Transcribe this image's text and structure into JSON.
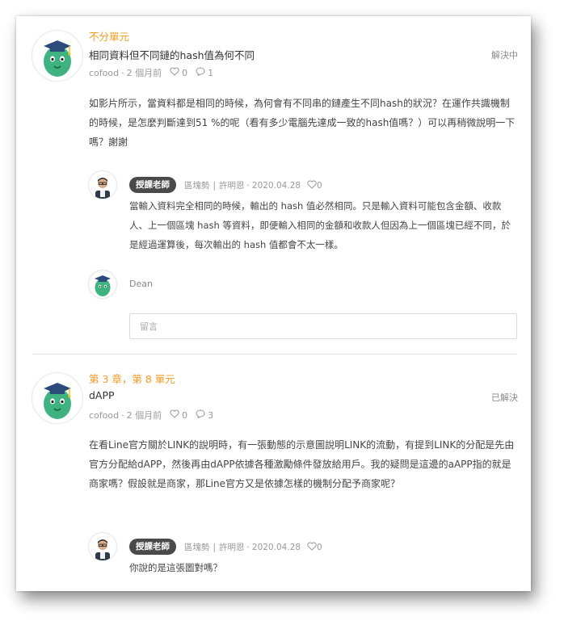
{
  "questions": [
    {
      "unit": "不分單元",
      "title": "相同資料但不同鏈的hash值為何不同",
      "status": "解決中",
      "author": "cofood",
      "time": "2 個月前",
      "likes": "0",
      "comments": "1",
      "body": "如影片所示，當資料都是相同的時候，為何會有不同串的鏈產生不同hash的狀況？在運作共識機制的時候，是怎麼判斷達到51 %的呢（看有多少電腦先達成一致的hash值嗎？）可以再稍微說明一下嗎？謝謝",
      "reply": {
        "badge": "授課老師",
        "course": "區塊勢",
        "teacher": "許明恩",
        "date": "2020.04.28",
        "likes": "0",
        "body": "當輸入資料完全相同的時候，輸出的 hash 值必然相同。只是輸入資料可能包含金額、收款人、上一個區塊 hash 等資料，即便輸入相同的金額和收款人但因為上一個區塊已經不同，於是經過運算後，每次輸出的 hash 值都會不太一樣。"
      },
      "commenter": "Dean",
      "comment_placeholder": "留言"
    },
    {
      "unit": "第 3 章，第 8 單元",
      "title": "dAPP",
      "status": "已解決",
      "author": "cofood",
      "time": "2 個月前",
      "likes": "0",
      "comments": "3",
      "body": "在看Line官方關於LINK的說明時，有一張動態的示意圖說明LINK的流動，有提到LINK的分配是先由官方分配給dAPP，然後再由dAPP依據各種激勵條件發放給用戶。我的疑問是這邊的aAPP指的就是商家嗎？假設就是商家，那Line官方又是依據怎樣的機制分配予商家呢？",
      "reply": {
        "badge": "授課老師",
        "course": "區塊勢",
        "teacher": "許明恩",
        "date": "2020.04.28",
        "likes": "0",
        "body": "你說的是這張圖對嗎？"
      }
    }
  ],
  "separators": {
    "dot": "·",
    "bar": "|"
  },
  "colors": {
    "accent": "#f39a1f",
    "mascot": "#3fb37f",
    "cap": "#2c4a7a"
  },
  "icons": {
    "like": "heart-icon",
    "comment": "chat-bubble-icon"
  }
}
